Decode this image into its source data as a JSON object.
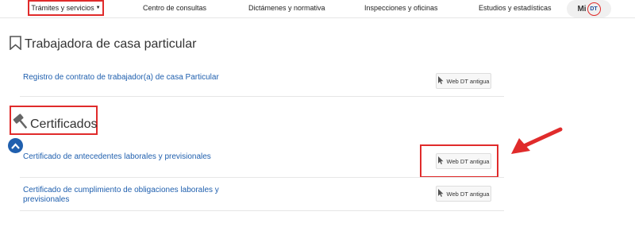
{
  "nav": {
    "items": [
      "Trámites y servicios",
      "Centro de consultas",
      "Dictámenes y normativa",
      "Inspecciones y oficinas",
      "Estudios y estadísticas"
    ],
    "mi_label": "Mi",
    "dt_label": "DT"
  },
  "sections": [
    {
      "title": "Trabajadora de casa particular",
      "items": [
        {
          "link": "Registro de contrato de trabajador(a) de casa Particular",
          "button": "Web DT antigua"
        }
      ]
    },
    {
      "title": "Certificados",
      "items": [
        {
          "link": "Certificado de antecedentes laborales y previsionales",
          "button": "Web DT antigua"
        },
        {
          "link_line1": "Certificado de cumplimiento de obligaciones laborales y",
          "link_line2": "previsionales",
          "button": "Web DT antigua"
        }
      ]
    }
  ],
  "colors": {
    "accent_red": "#e02b2b",
    "link_blue": "#1f5fae"
  }
}
